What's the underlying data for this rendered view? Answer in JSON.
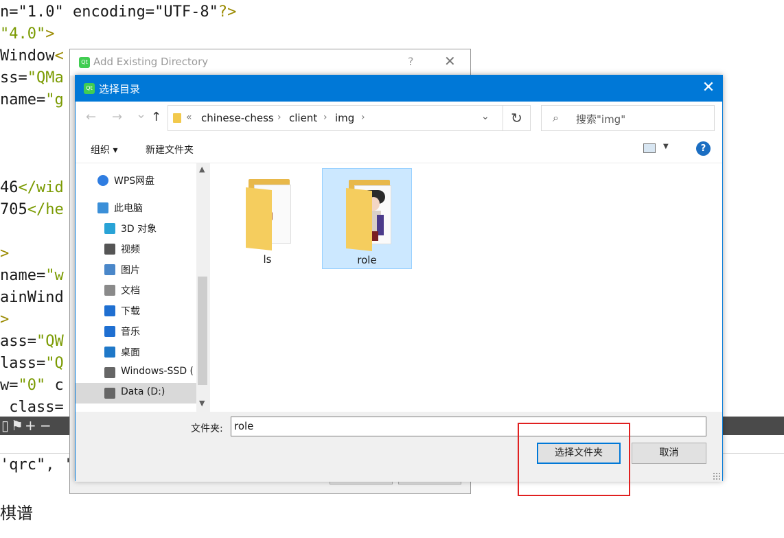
{
  "editor": {
    "code_lines": [
      [
        {
          "c": "b",
          "t": "n=\"1.0\" encoding=\"UTF-8\""
        },
        {
          "c": "y",
          "t": "?>"
        }
      ],
      [
        {
          "c": "g",
          "t": "\"4.0\""
        },
        {
          "c": "y",
          "t": ">"
        }
      ],
      [
        {
          "c": "b",
          "t": "Window"
        },
        {
          "c": "y",
          "t": "<"
        }
      ],
      [
        {
          "c": "b",
          "t": "ss="
        },
        {
          "c": "g",
          "t": "\"QMa"
        }
      ],
      [
        {
          "c": "b",
          "t": "name="
        },
        {
          "c": "g",
          "t": "\"g"
        }
      ],
      [
        {
          "c": "b",
          "t": ""
        }
      ],
      [
        {
          "c": "b",
          "t": ""
        }
      ],
      [
        {
          "c": "b",
          "t": ""
        }
      ],
      [
        {
          "c": "b",
          "t": "46"
        },
        {
          "c": "g",
          "t": "</wid"
        }
      ],
      [
        {
          "c": "b",
          "t": "705"
        },
        {
          "c": "g",
          "t": "</he"
        }
      ],
      [
        {
          "c": "b",
          "t": ""
        }
      ],
      [
        {
          "c": "y",
          "t": ">"
        }
      ],
      [
        {
          "c": "b",
          "t": "name="
        },
        {
          "c": "g",
          "t": "\"w"
        }
      ],
      [
        {
          "c": "b",
          "t": "ainWind"
        }
      ],
      [
        {
          "c": "y",
          "t": ">"
        }
      ],
      [
        {
          "c": "b",
          "t": "ass="
        },
        {
          "c": "g",
          "t": "\"QW"
        }
      ],
      [
        {
          "c": "b",
          "t": "lass="
        },
        {
          "c": "g",
          "t": "\"Q"
        }
      ],
      [
        {
          "c": "b",
          "t": "w="
        },
        {
          "c": "g",
          "t": "\"0\""
        },
        {
          "c": "b",
          "t": " c"
        }
      ],
      [
        {
          "c": "b",
          "t": " class="
        }
      ]
    ],
    "bottom_code": "'qrc\", '",
    "bottom_text": "棋谱"
  },
  "back_dialog": {
    "title": "Add Existing Directory",
    "help_glyph": "?",
    "close_glyph": "✕"
  },
  "dialog": {
    "title": "选择目录",
    "close_glyph": "✕",
    "nav": {
      "back_glyph": "←",
      "forward_glyph": "→",
      "recent_glyph": "⌄",
      "up_glyph": "↑",
      "breadcrumb_lead": "«",
      "breadcrumbs": [
        "chinese-chess",
        "client",
        "img"
      ],
      "crumb_sep": "›",
      "address_dropdown_glyph": "⌄",
      "refresh_glyph": "↻",
      "search_glyph": "⌕",
      "search_placeholder": "搜索\"img\""
    },
    "toolbar": {
      "organize": "组织 ▾",
      "new_folder": "新建文件夹",
      "view_dropdown_glyph": "▼",
      "help": "?"
    },
    "sidebar": {
      "scroll_up_glyph": "▲",
      "scroll_down_glyph": "▼",
      "items": [
        {
          "label": "WPS网盘",
          "icon": "cloud-icon",
          "indent": 0,
          "selected": false,
          "color": "#2f7de1"
        },
        {
          "label": "此电脑",
          "icon": "computer-icon",
          "indent": 0,
          "selected": false,
          "color": "#3b8fd8"
        },
        {
          "label": "3D 对象",
          "icon": "3d-objects-icon",
          "indent": 1,
          "selected": false,
          "color": "#29a3d6"
        },
        {
          "label": "视频",
          "icon": "video-icon",
          "indent": 1,
          "selected": false,
          "color": "#555555"
        },
        {
          "label": "图片",
          "icon": "pictures-icon",
          "indent": 1,
          "selected": false,
          "color": "#4a87c9"
        },
        {
          "label": "文档",
          "icon": "documents-icon",
          "indent": 1,
          "selected": false,
          "color": "#8a8a8a"
        },
        {
          "label": "下载",
          "icon": "download-icon",
          "indent": 1,
          "selected": false,
          "color": "#1f6fd1"
        },
        {
          "label": "音乐",
          "icon": "music-icon",
          "indent": 1,
          "selected": false,
          "color": "#1f6fd1"
        },
        {
          "label": "桌面",
          "icon": "desktop-icon",
          "indent": 1,
          "selected": false,
          "color": "#1f78c8"
        },
        {
          "label": "Windows-SSD (",
          "icon": "drive-icon",
          "indent": 1,
          "selected": false,
          "color": "#666666"
        },
        {
          "label": "Data (D:)",
          "icon": "drive-icon",
          "indent": 1,
          "selected": true,
          "color": "#666666"
        }
      ]
    },
    "folders": [
      {
        "name": "ls",
        "selected": false
      },
      {
        "name": "role",
        "selected": true
      }
    ],
    "footer": {
      "folder_label": "文件夹:",
      "folder_value": "role",
      "select_button": "选择文件夹",
      "cancel_button": "取消"
    }
  },
  "colors": {
    "accent": "#0078d7",
    "annotation": "#e02020",
    "selection": "#cce8ff"
  }
}
